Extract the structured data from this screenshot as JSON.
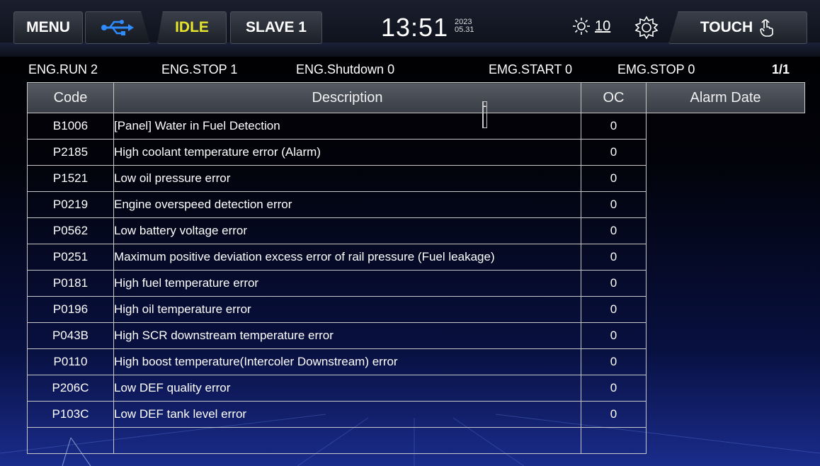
{
  "topbar": {
    "menu_label": "MENU",
    "usb_icon": "usb-icon",
    "idle_label": "IDLE",
    "slave_label": "SLAVE 1",
    "clock_time": "13:51",
    "clock_year": "2023",
    "clock_date": "05.31",
    "brightness_icon": "brightness-icon",
    "brightness_value": "10",
    "settings_icon": "settings-icon",
    "touch_label": "TOUCH",
    "touch_icon": "touch-hand-icon",
    "idle_color": "#e8e62a"
  },
  "status": {
    "eng_run": "ENG.RUN 2",
    "eng_stop": "ENG.STOP 1",
    "eng_shutdown": "ENG.Shutdown 0",
    "emg_start": "EMG.START 0",
    "emg_stop": "EMG.STOP 0",
    "page": "1/1"
  },
  "table": {
    "headers": [
      "Code",
      "Description",
      "OC",
      "Alarm Date"
    ],
    "rows": [
      {
        "code": "B1006",
        "description": "[Panel] Water in Fuel Detection",
        "oc": "0",
        "date": "-"
      },
      {
        "code": "P2185",
        "description": "High coolant temperature error (Alarm)",
        "oc": "0",
        "date": "-"
      },
      {
        "code": "P1521",
        "description": "Low oil pressure error",
        "oc": "0",
        "date": "-"
      },
      {
        "code": "P0219",
        "description": "Engine overspeed detection error",
        "oc": "0",
        "date": "-"
      },
      {
        "code": "P0562",
        "description": "Low battery voltage error",
        "oc": "0",
        "date": "-"
      },
      {
        "code": "P0251",
        "description": "Maximum positive deviation excess error of rail pressure (Fuel leakage)",
        "oc": "0",
        "date": "-"
      },
      {
        "code": "P0181",
        "description": "High fuel temperature error",
        "oc": "0",
        "date": "-"
      },
      {
        "code": "P0196",
        "description": "High oil temperature error",
        "oc": "0",
        "date": "-"
      },
      {
        "code": "P043B",
        "description": "High SCR downstream temperature error",
        "oc": "0",
        "date": "-"
      },
      {
        "code": "P0110",
        "description": "High boost temperature(Intercoler Downstream) error",
        "oc": "0",
        "date": "-"
      },
      {
        "code": "P206C",
        "description": "Low DEF quality error",
        "oc": "0",
        "date": "-"
      },
      {
        "code": "P103C",
        "description": "Low DEF tank level error",
        "oc": "0",
        "date": "-"
      },
      {
        "code": "",
        "description": "",
        "oc": "",
        "date": ""
      }
    ]
  }
}
